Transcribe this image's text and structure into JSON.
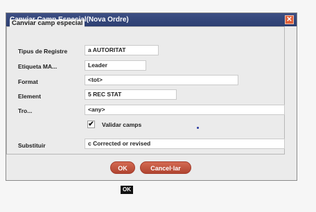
{
  "dialog": {
    "title": "Canviar Camp Especial(Nova Ordre)",
    "close_glyph": "✕"
  },
  "section": {
    "legend": "Canviar camp especial"
  },
  "rows": {
    "tipus": {
      "label": "Tipus de Registre",
      "value": "a  AUTORITAT"
    },
    "etiqueta": {
      "label": "Etiqueta MA...",
      "value": "Leader"
    },
    "format": {
      "label": "Format",
      "value": "<tot>"
    },
    "element": {
      "label": "Element",
      "value": "5  REC STAT"
    },
    "tro": {
      "label": "Tro...",
      "value": "<any>"
    },
    "substituir": {
      "label": "Substituir",
      "value": "c Corrected or revised"
    }
  },
  "validar": {
    "label": "Validar camps",
    "checked": true,
    "check_glyph": "✔"
  },
  "buttons": {
    "ok": "OK",
    "cancel": "Cancel·lar"
  },
  "tooltip": {
    "text": "OK"
  },
  "icons": [
    "close-icon",
    "check-icon"
  ],
  "colors": {
    "titlebar": "#2d3f72",
    "button": "#c0553e",
    "close": "#e0603a"
  }
}
